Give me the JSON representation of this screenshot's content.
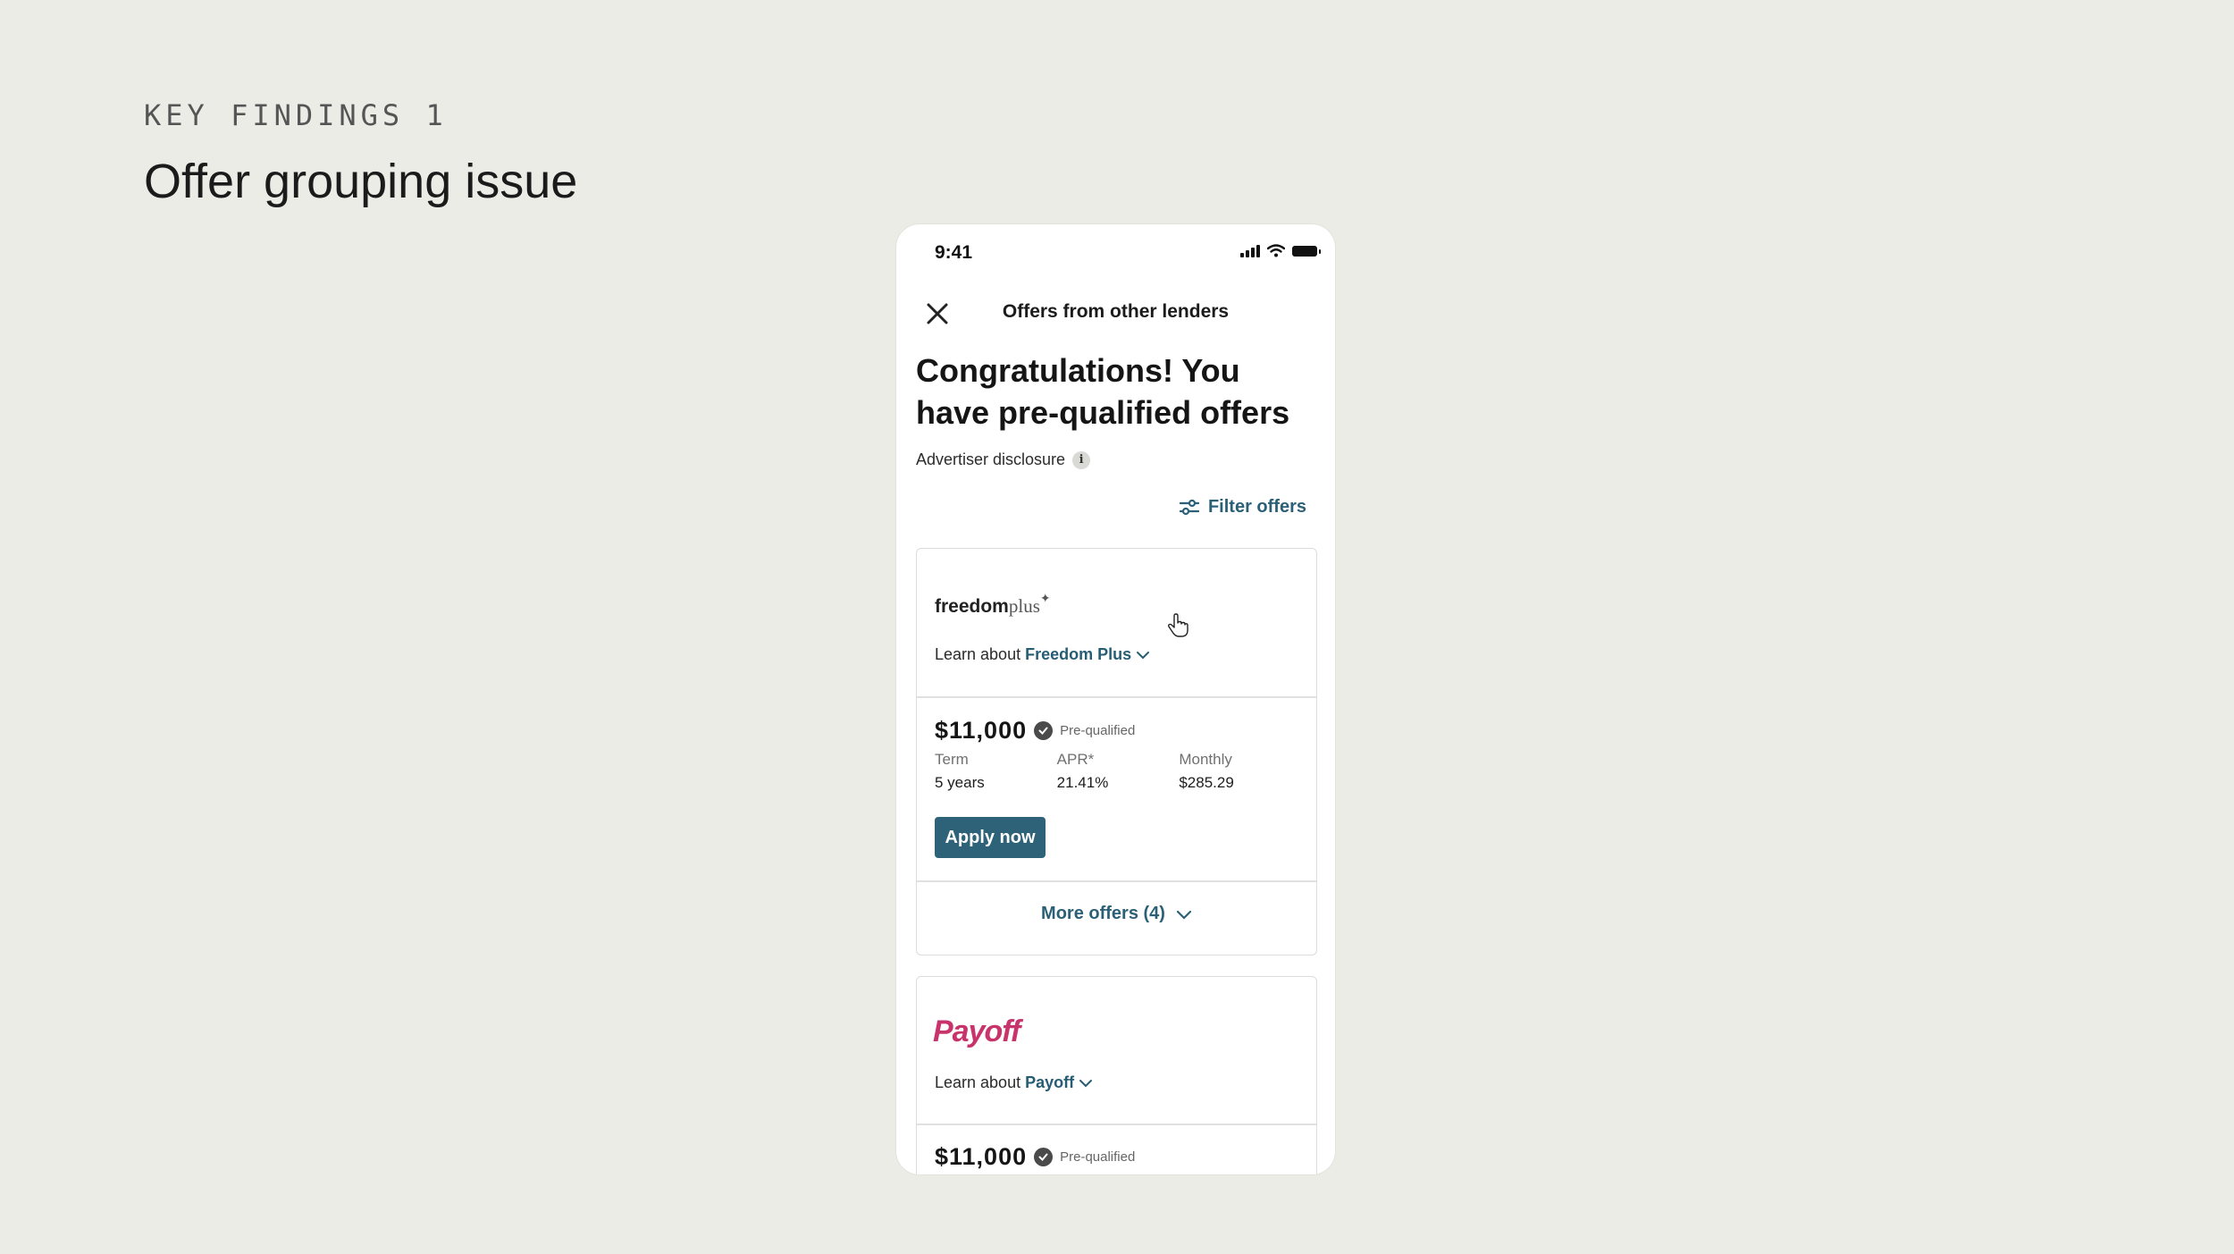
{
  "slide": {
    "eyebrow": "KEY FINDINGS 1",
    "title": "Offer grouping issue"
  },
  "status_bar": {
    "time": "9:41",
    "icons": [
      "signal-icon",
      "wifi-icon",
      "battery-icon"
    ]
  },
  "nav": {
    "title": "Offers from other lenders",
    "close_icon": "close-icon"
  },
  "headline": "Congratulations! You have pre-qualified offers",
  "disclosure": {
    "label": "Advertiser disclosure",
    "icon_glyph": "i"
  },
  "filter": {
    "label": "Filter offers",
    "icon": "sliders-icon"
  },
  "offers": [
    {
      "logo": {
        "bold": "freedom",
        "light": "plus",
        "mark": "✦"
      },
      "learn_prefix": "Learn about",
      "lender_name": "Freedom Plus",
      "amount": "$11,000",
      "badge": "Pre-qualified",
      "terms": [
        {
          "label": "Term",
          "value": "5 years"
        },
        {
          "label": "APR*",
          "value": "21.41%"
        },
        {
          "label": "Monthly",
          "value": "$285.29"
        }
      ],
      "apply_label": "Apply now",
      "more_offers_label": "More offers (4)"
    },
    {
      "logo": {
        "text": "Payoff"
      },
      "learn_prefix": "Learn about",
      "lender_name": "Payoff",
      "amount": "$11,000",
      "badge": "Pre-qualified"
    }
  ],
  "colors": {
    "background": "#ecece7",
    "accent": "#2d6279",
    "payoff_brand": "#c8336b"
  }
}
